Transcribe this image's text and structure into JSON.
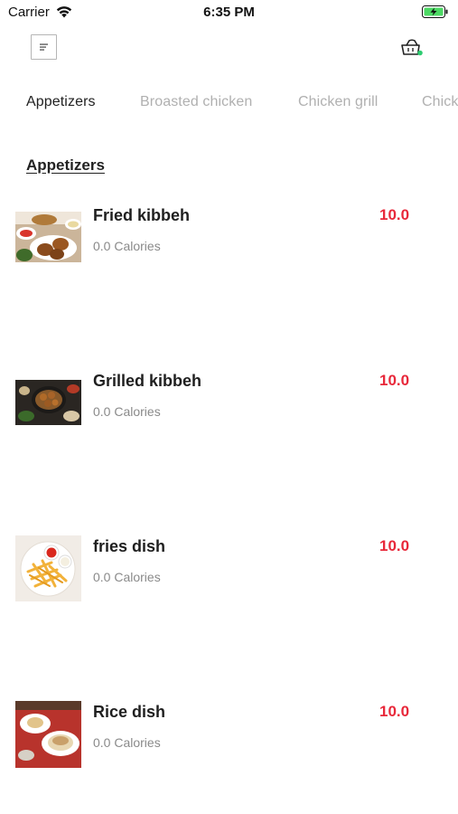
{
  "status_bar": {
    "carrier": "Carrier",
    "time": "6:35 PM",
    "wifi_icon": "wifi-icon",
    "battery_icon": "battery-charging-icon"
  },
  "header": {
    "menu_icon": "menu-icon",
    "cart_icon": "shopping-basket-icon"
  },
  "tabs": [
    {
      "label": "Appetizers",
      "active": true
    },
    {
      "label": "Broasted chicken",
      "active": false
    },
    {
      "label": "Chicken grill",
      "active": false
    },
    {
      "label": "Chick",
      "active": false
    }
  ],
  "section": {
    "title": "Appetizers"
  },
  "items": [
    {
      "name": "Fried kibbeh",
      "calories": "0.0 Calories",
      "price": "10.0"
    },
    {
      "name": "Grilled kibbeh",
      "calories": "0.0 Calories",
      "price": "10.0"
    },
    {
      "name": "fries dish",
      "calories": "0.0 Calories",
      "price": "10.0"
    },
    {
      "name": "Rice dish",
      "calories": "0.0 Calories",
      "price": "10.0"
    }
  ],
  "colors": {
    "accent_price": "#e8283a",
    "tab_active": "#222222",
    "tab_inactive": "#b0b0b0",
    "cart_dot": "#2ecc71",
    "battery": "#4cd964"
  }
}
